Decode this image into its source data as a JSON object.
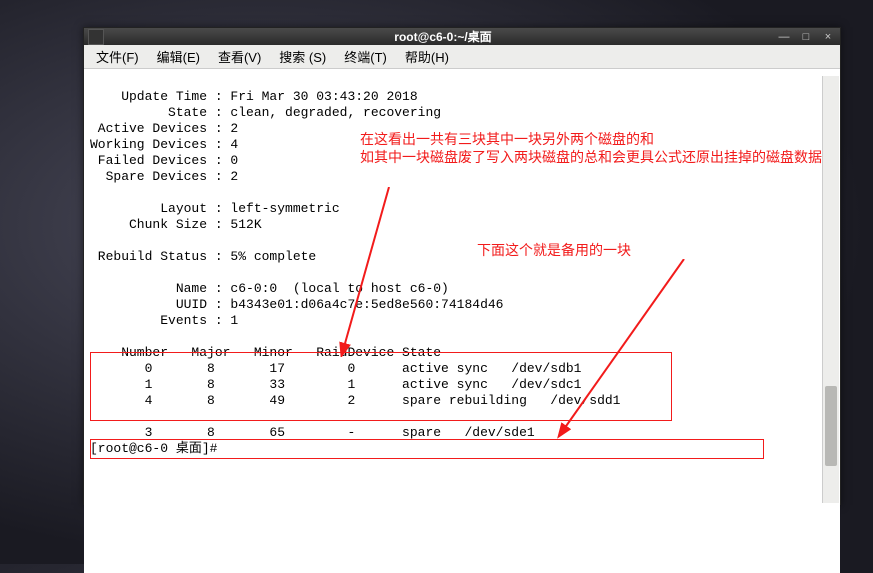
{
  "title": "root@c6-0:~/桌面",
  "menu": {
    "file": "文件(F)",
    "edit": "编辑(E)",
    "view": "查看(V)",
    "search": "搜索 (S)",
    "terminal": "终端(T)",
    "help": "帮助(H)"
  },
  "annotations": {
    "a1": "在这看出一共有三块其中一块另外两个磁盘的和\n如其中一块磁盘废了写入两块磁盘的总和会更具公式还原出挂掉的磁盘数据",
    "a2": "下面这个就是备用的一块"
  },
  "lines": {
    "l0": "    Update Time : Fri Mar 30 03:43:20 2018",
    "l1": "          State : clean, degraded, recovering",
    "l2": " Active Devices : 2",
    "l3": "Working Devices : 4",
    "l4": " Failed Devices : 0",
    "l5": "  Spare Devices : 2",
    "l6": "",
    "l7": "         Layout : left-symmetric",
    "l8": "     Chunk Size : 512K",
    "l9": "",
    "l10": " Rebuild Status : 5% complete",
    "l11": "",
    "l12": "           Name : c6-0:0  (local to host c6-0)",
    "l13": "           UUID : b4343e01:d06a4c7e:5ed8e560:74184d46",
    "l14": "         Events : 1",
    "l15": "",
    "l16": "    Number   Major   Minor   RaidDevice State",
    "l17": "       0       8       17        0      active sync   /dev/sdb1",
    "l18": "       1       8       33        1      active sync   /dev/sdc1",
    "l19": "       4       8       49        2      spare rebuilding   /dev/sdd1",
    "l20": "",
    "l21": "       3       8       65        -      spare   /dev/sde1",
    "l22": "[root@c6-0 桌面]# "
  }
}
